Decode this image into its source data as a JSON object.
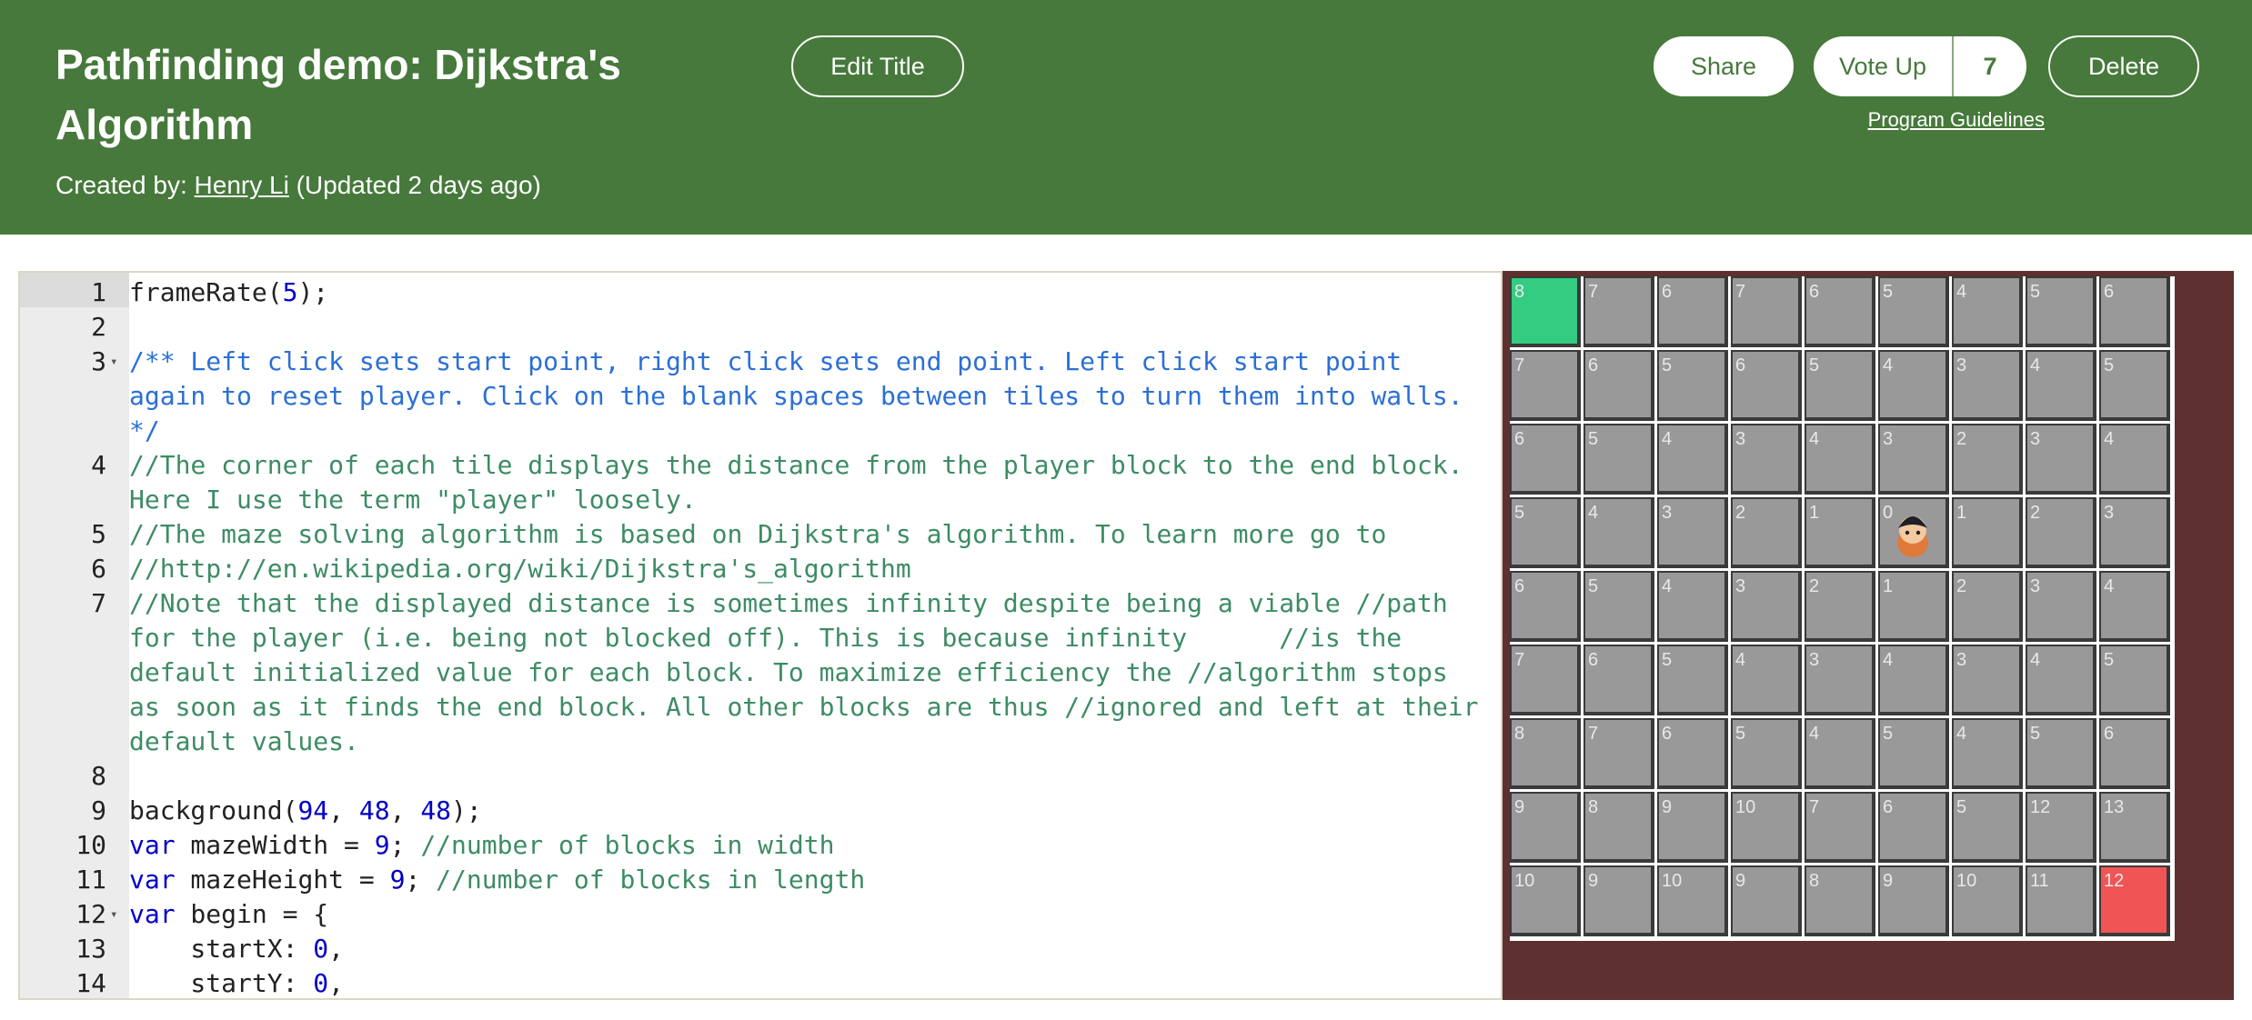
{
  "header": {
    "title_line1": "Pathfinding demo: Dijkstra's",
    "title_line2": "Algorithm",
    "created_by_label": "Created by:",
    "author": "Henry Li",
    "updated": "(Updated 2 days ago)",
    "edit_title_label": "Edit Title",
    "share_label": "Share",
    "vote_up_label": "Vote Up",
    "vote_count": "7",
    "delete_label": "Delete",
    "guidelines_label": "Program Guidelines"
  },
  "editor": {
    "line_numbers": [
      "1",
      "2",
      "3",
      "4",
      "5",
      "6",
      "7",
      "8",
      "9",
      "10",
      "11",
      "12",
      "13",
      "14"
    ]
  },
  "maze": {
    "distances": [
      [
        "8",
        "7",
        "6",
        "7",
        "6",
        "5",
        "4",
        "5",
        "6"
      ],
      [
        "7",
        "6",
        "5",
        "6",
        "5",
        "4",
        "3",
        "4",
        "5"
      ],
      [
        "6",
        "5",
        "4",
        "3",
        "4",
        "3",
        "2",
        "3",
        "4"
      ],
      [
        "5",
        "4",
        "3",
        "2",
        "1",
        "0",
        "1",
        "2",
        "3"
      ],
      [
        "6",
        "5",
        "4",
        "3",
        "2",
        "1",
        "2",
        "3",
        "4"
      ],
      [
        "7",
        "6",
        "5",
        "4",
        "3",
        "4",
        "3",
        "4",
        "5"
      ],
      [
        "8",
        "7",
        "6",
        "5",
        "4",
        "5",
        "4",
        "5",
        "6"
      ],
      [
        "9",
        "8",
        "9",
        "10",
        "7",
        "6",
        "5",
        "12",
        "13"
      ],
      [
        "10",
        "9",
        "10",
        "9",
        "8",
        "9",
        "10",
        "11",
        "12"
      ]
    ],
    "start_cell": [
      0,
      0
    ],
    "end_cell": [
      8,
      8
    ],
    "player_cell": [
      3,
      5
    ],
    "colors": {
      "background": "#5e3030",
      "tile": "#999999",
      "start": "#33cc80",
      "end": "#f05555",
      "gap": "#ffffff",
      "player_skin": "#e07a3a"
    }
  }
}
